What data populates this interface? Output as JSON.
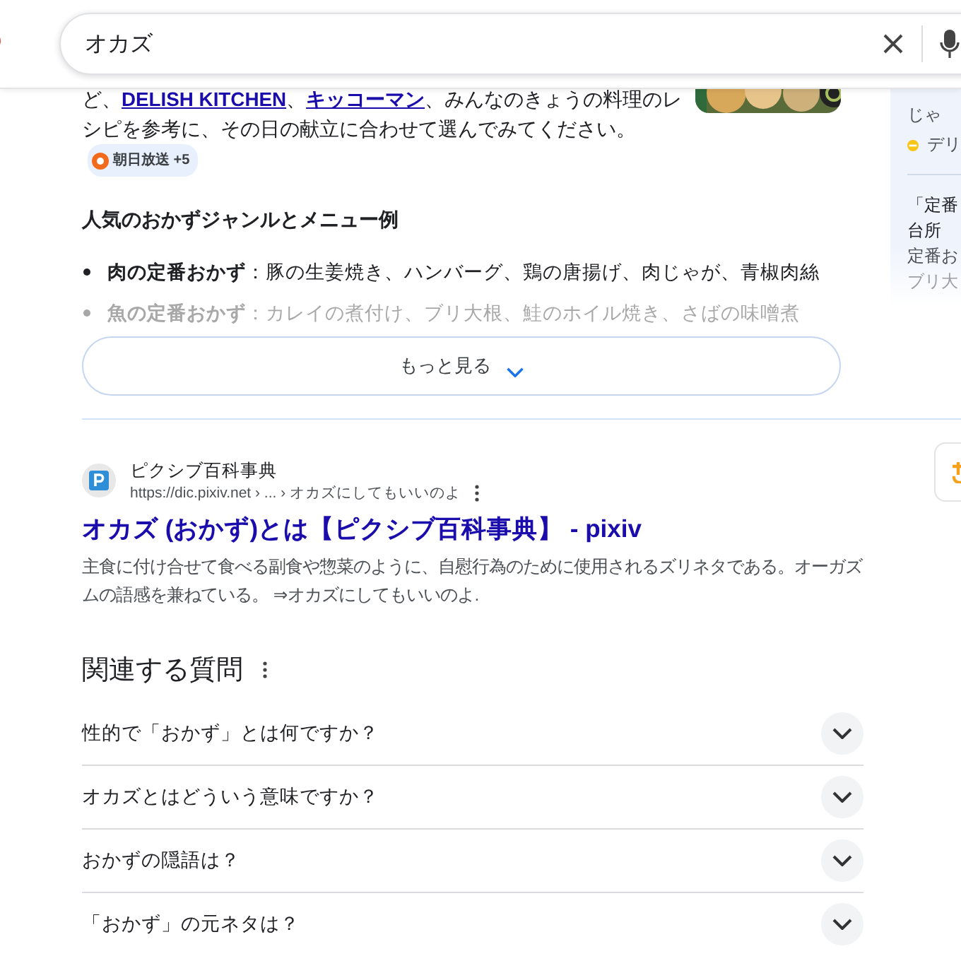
{
  "search": {
    "value": "オカズ"
  },
  "snippet": {
    "parts": [
      {
        "kind": "text",
        "text": "ど、"
      },
      {
        "kind": "link",
        "text": "DELISH KITCHEN"
      },
      {
        "kind": "text",
        "text": "、"
      },
      {
        "kind": "link",
        "text": "キッコーマン"
      },
      {
        "kind": "text",
        "text": "、みんなのきょうの料理のレシピを参考に、その日の献立に合わせて選んでみてください。"
      }
    ],
    "source": "朝日放送 +5",
    "heading": "人気のおかずジャンルとメニュー例",
    "bullets": [
      {
        "term": "肉の定番おかず",
        "text": "：豚の生姜焼き、ハンバーグ、鶏の唐揚げ、肉じゃが、青椒肉絲",
        "faded": false
      },
      {
        "term": "魚の定番おかず",
        "text": "：カレイの煮付け、ブリ大根、鮭のホイル焼き、さばの味噌煮",
        "faded": true
      }
    ],
    "more_button": "もっと見る"
  },
  "side": {
    "items": [
      {
        "kind": "text",
        "text": "じゃ"
      },
      {
        "kind": "source",
        "text": "デリ"
      },
      {
        "kind": "title",
        "text": "「定番"
      },
      {
        "kind": "title",
        "text": "台所"
      },
      {
        "kind": "text",
        "text": "定番お"
      },
      {
        "kind": "faded",
        "text": "ブリ大"
      }
    ]
  },
  "result": {
    "site": "ピクシブ百科事典",
    "url": "https://dic.pixiv.net › ... › オカズにしてもいいのよ",
    "title": "オカズ (おかず)とは【ピクシブ百科事典】 - pixiv",
    "description": "主食に付け合せて食べる副食や惣菜のように、自慰行為のために使用されるズリネタである。オーガズムの語感を兼ねている。 ⇒オカズにしてもいいのよ."
  },
  "related": {
    "heading": "関連する質問",
    "questions": [
      {
        "text": "性的で「おかず」とは何ですか？",
        "expanded": false
      },
      {
        "text": "オカズとはどういう意味ですか？",
        "expanded": false
      },
      {
        "text": "おかずの隠語は？",
        "expanded": false
      },
      {
        "text": "「おかず」の元ネタは？",
        "expanded": false
      }
    ]
  }
}
